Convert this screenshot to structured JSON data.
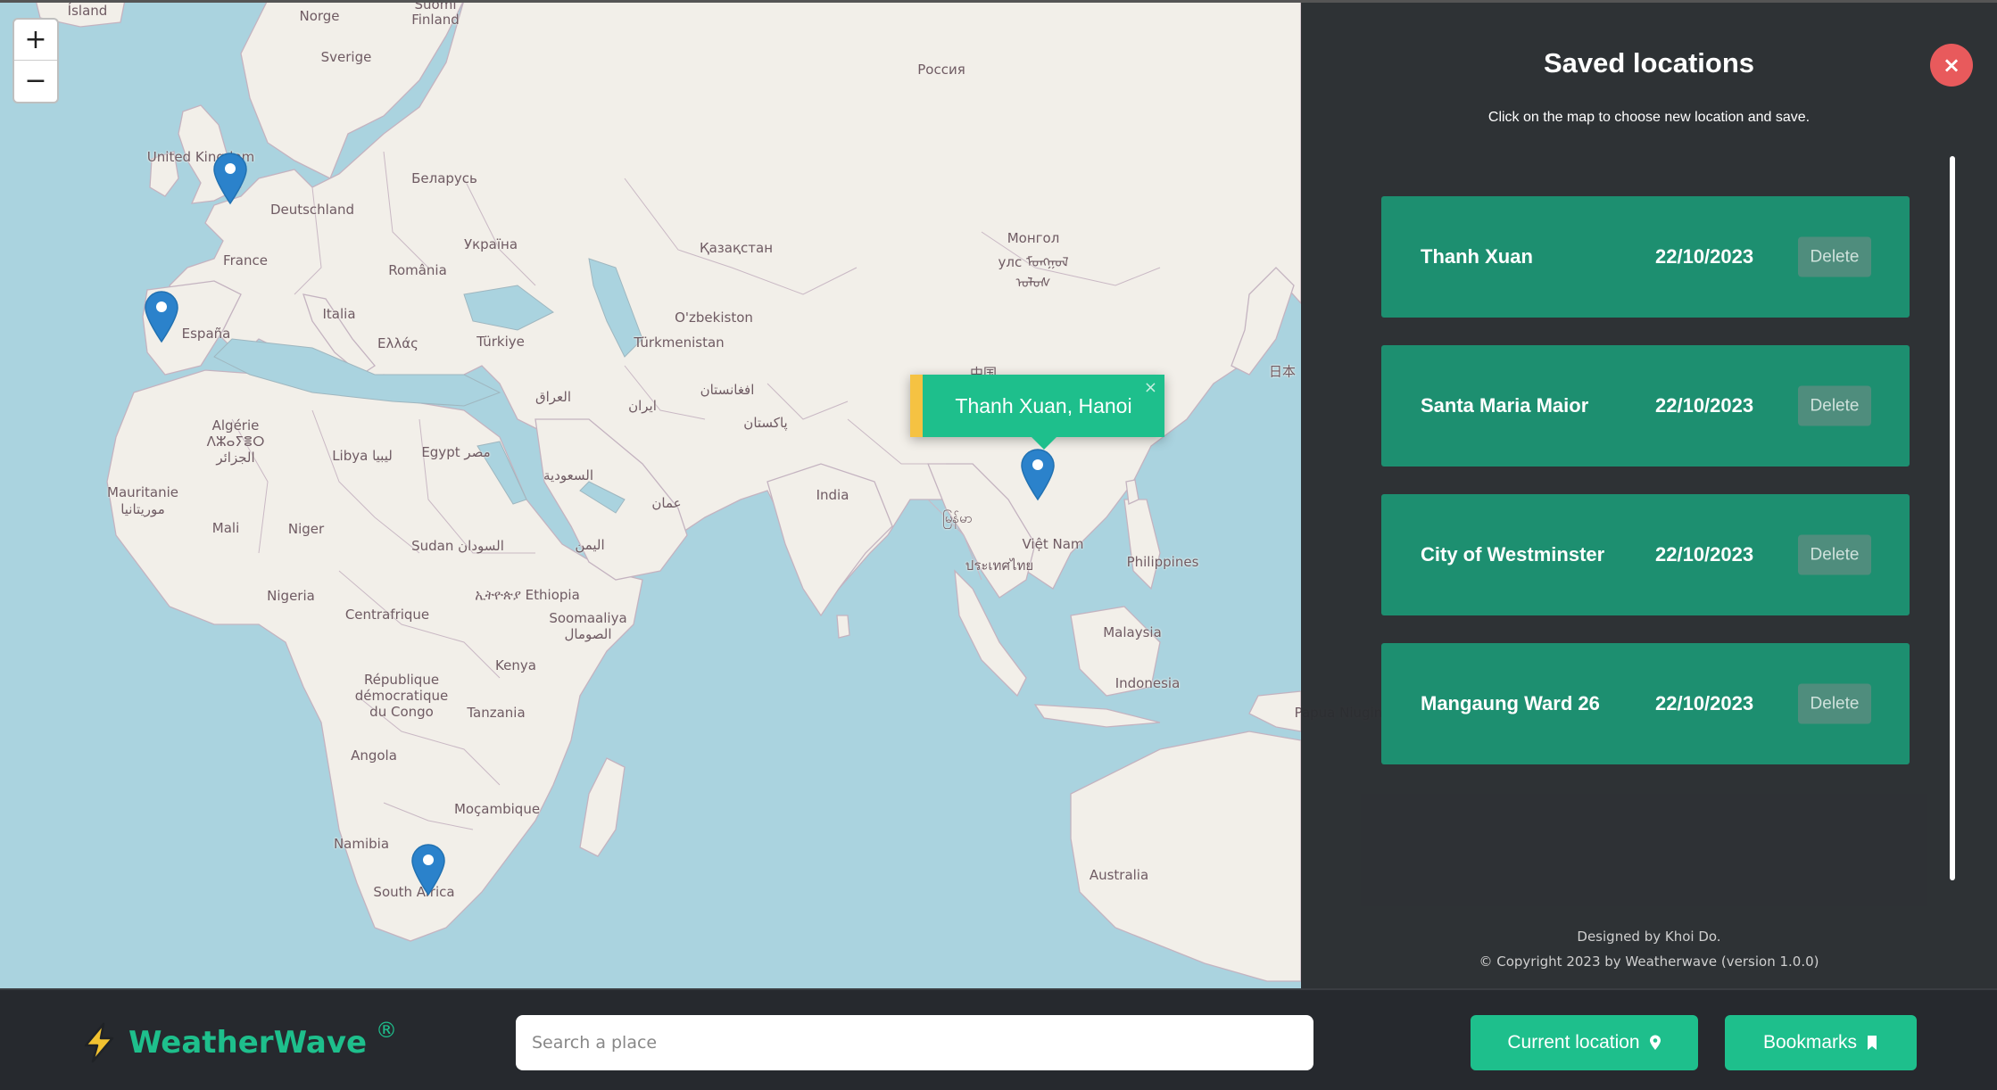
{
  "map": {
    "zoom_in": "+",
    "zoom_out": "−",
    "labels": [
      {
        "key": "island",
        "text": "Ísland"
      },
      {
        "key": "norge",
        "text": "Norge"
      },
      {
        "key": "suomi",
        "text": "Suomi"
      },
      {
        "key": "finland",
        "text": "Finland"
      },
      {
        "key": "sverige",
        "text": "Sverige"
      },
      {
        "key": "rossiya",
        "text": "Россия"
      },
      {
        "key": "uk",
        "text": "United Kingdom"
      },
      {
        "key": "belarus",
        "text": "Беларусь"
      },
      {
        "key": "deutschland",
        "text": "Deutschland"
      },
      {
        "key": "france",
        "text": "France"
      },
      {
        "key": "ukraina",
        "text": "Україна"
      },
      {
        "key": "romania",
        "text": "România"
      },
      {
        "key": "kazakhstan",
        "text": "Қазақстан"
      },
      {
        "key": "mongol",
        "text": "Монгол"
      },
      {
        "key": "mongol2",
        "text": "улс ᠮᠣᠩᠭᠣᠯ"
      },
      {
        "key": "mongol3",
        "text": "ᠤᠯᠤᠰ"
      },
      {
        "key": "espana",
        "text": "España"
      },
      {
        "key": "italia",
        "text": "Italia"
      },
      {
        "key": "ellas",
        "text": "Ελλάς"
      },
      {
        "key": "turkiye",
        "text": "Türkiye"
      },
      {
        "key": "uzbekiston",
        "text": "O'zbekiston"
      },
      {
        "key": "turkmenistan",
        "text": "Türkmenistan"
      },
      {
        "key": "nihon",
        "text": "日本"
      },
      {
        "key": "zhongguo",
        "text": "中国"
      },
      {
        "key": "afghanistan",
        "text": "افغانستان"
      },
      {
        "key": "iraq",
        "text": "العراق"
      },
      {
        "key": "iran",
        "text": "ایران"
      },
      {
        "key": "pakistan",
        "text": "پاکستان"
      },
      {
        "key": "algerie",
        "text": "Algérie"
      },
      {
        "key": "algerie2",
        "text": "ⴷⵣⴰⵢⴻⵔ"
      },
      {
        "key": "algerie3",
        "text": "الجزائر"
      },
      {
        "key": "libya",
        "text": "Libya ليبيا"
      },
      {
        "key": "egypt",
        "text": "Egypt مصر"
      },
      {
        "key": "saudi",
        "text": "السعودية"
      },
      {
        "key": "oman",
        "text": "عمان"
      },
      {
        "key": "india",
        "text": "India"
      },
      {
        "key": "myanmar",
        "text": "မြန်မာ"
      },
      {
        "key": "vietnam",
        "text": "Việt Nam"
      },
      {
        "key": "thailand",
        "text": "ประเทศไทย"
      },
      {
        "key": "philippines",
        "text": "Philippines"
      },
      {
        "key": "mauritanie",
        "text": "Mauritanie"
      },
      {
        "key": "mauritanie2",
        "text": "موريتانيا"
      },
      {
        "key": "mali",
        "text": "Mali"
      },
      {
        "key": "niger",
        "text": "Niger"
      },
      {
        "key": "sudan",
        "text": "Sudan السودان"
      },
      {
        "key": "yemen",
        "text": "اليمن"
      },
      {
        "key": "ethiopia",
        "text": "ኢትዮጵያ Ethiopia"
      },
      {
        "key": "nigeria",
        "text": "Nigeria"
      },
      {
        "key": "centrafrique",
        "text": "Centrafrique"
      },
      {
        "key": "soomaaliya",
        "text": "Soomaaliya"
      },
      {
        "key": "soomaaliya2",
        "text": "الصومال"
      },
      {
        "key": "malaysia",
        "text": "Malaysia"
      },
      {
        "key": "kenya",
        "text": "Kenya"
      },
      {
        "key": "rdc1",
        "text": "République"
      },
      {
        "key": "rdc2",
        "text": "démocratique"
      },
      {
        "key": "rdc3",
        "text": "du Congo"
      },
      {
        "key": "tanzania",
        "text": "Tanzania"
      },
      {
        "key": "indonesia",
        "text": "Indonesia"
      },
      {
        "key": "papua",
        "text": "Papua Niugini"
      },
      {
        "key": "angola",
        "text": "Angola"
      },
      {
        "key": "mocambique",
        "text": "Moçambique"
      },
      {
        "key": "namibia",
        "text": "Namibia"
      },
      {
        "key": "australia",
        "text": "Australia"
      },
      {
        "key": "south_africa",
        "text": "South Africa"
      }
    ],
    "popup": {
      "text": "Thanh Xuan, Hanoi",
      "close": "×"
    },
    "markers": [
      "London",
      "Lisbon",
      "Bloemfontein",
      "Hanoi"
    ],
    "colors": {
      "water": "#aad3df",
      "land": "#f2efe9",
      "marker": "#2b82cb",
      "popup": "#1ebf8c",
      "popup_accent": "#f5c242"
    }
  },
  "sidebar": {
    "title": "Saved locations",
    "close": "×",
    "instruction": "Click on the map to choose new location and save.",
    "locations": [
      {
        "name": "Thanh Xuan",
        "date": "22/10/2023",
        "action": "Delete"
      },
      {
        "name": "Santa Maria Maior",
        "date": "22/10/2023",
        "action": "Delete"
      },
      {
        "name": "City of Westminster",
        "date": "22/10/2023",
        "action": "Delete"
      },
      {
        "name": "Mangaung Ward 26",
        "date": "22/10/2023",
        "action": "Delete"
      }
    ],
    "footer": {
      "credit": "Designed by Khoi Do.",
      "copyright": "© Copyright 2023 by Weatherwave (version 1.0.0)"
    },
    "colors": {
      "background": "#2a2c30",
      "card": "#1d8f70",
      "close": "#e85a5c"
    }
  },
  "bottom_bar": {
    "brand": {
      "name": "WeatherWave",
      "mark": "®",
      "icon": "lightning-bolt-icon"
    },
    "search": {
      "placeholder": "Search a place",
      "value": ""
    },
    "current_location": {
      "label": "Current location",
      "icon": "map-pin-icon"
    },
    "bookmarks": {
      "label": "Bookmarks",
      "icon": "bookmark-icon"
    },
    "colors": {
      "accent": "#1ebf8c",
      "background": "#26292e"
    }
  }
}
